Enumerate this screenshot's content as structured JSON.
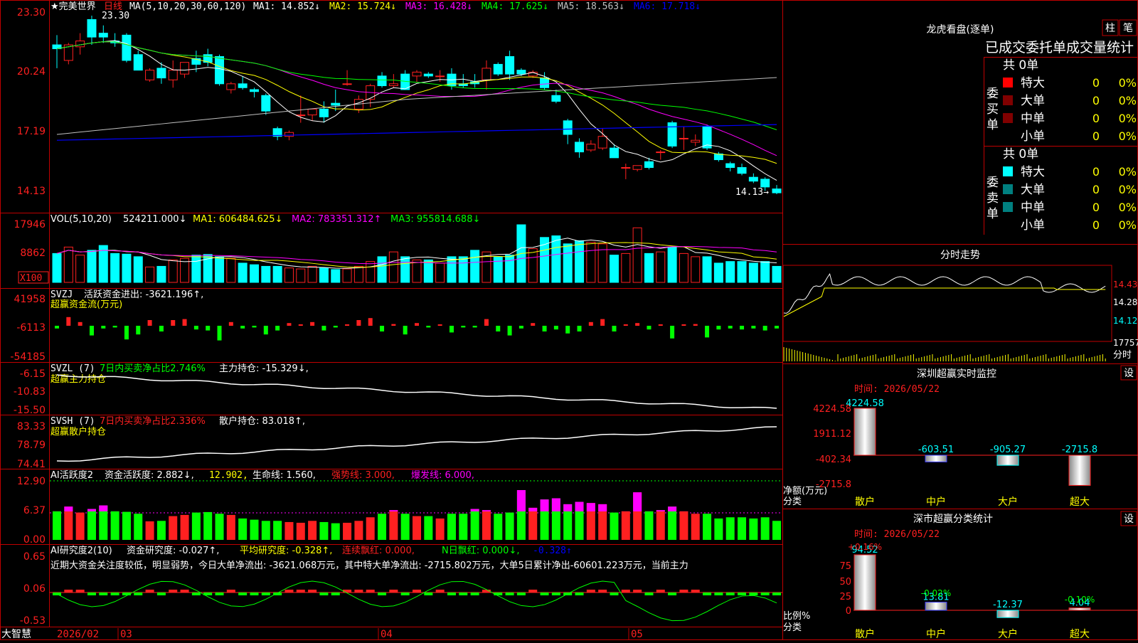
{
  "colors": {
    "up": "#ff2020",
    "down": "#00ffff",
    "frame": "#c00000",
    "ma1": "#ffffff",
    "ma2": "#ffff00",
    "ma3": "#ff00ff",
    "ma4": "#00ff00",
    "ma5": "#c0c0c0",
    "ma6": "#0000ff",
    "green": "#00ff00",
    "label": "#ffff00"
  },
  "kline": {
    "stock_name": "★完美世界",
    "period": "日线",
    "ma_label": "MA(5,10,20,30,60,120)",
    "ma_values": [
      "MA1: 14.852↓",
      "MA2: 15.724↓",
      "MA3: 16.428↓",
      "MA4: 17.625↓",
      "MA5: 18.563↓",
      "MA6: 17.718↓"
    ],
    "y_ticks": [
      "23.30",
      "20.24",
      "17.19",
      "14.13"
    ],
    "high_label": "23.30",
    "low_label": "14.13→"
  },
  "vol": {
    "label": "VOL(5,10,20)",
    "value": "524211.000↓",
    "ma_values": [
      "MA1: 606484.625↓",
      "MA2: 783351.312↑",
      "MA3: 955814.688↓"
    ],
    "y_ticks": [
      "17946",
      "8862"
    ],
    "unit": "X100"
  },
  "svzj": {
    "label": "SVZJ",
    "title": "活跃资金进出: -3621.196↑,",
    "sub": "超赢资金流(万元)",
    "y_ticks": [
      "41958",
      "-6113",
      "-54185"
    ]
  },
  "svzl": {
    "label": "SVZL (7)",
    "title1": "7日内买卖净占比2.746%",
    "title2": "主力持仓: -15.329↓,",
    "sub": "超赢主力持仓",
    "y_ticks": [
      "-6.15",
      "-10.83",
      "-15.50"
    ]
  },
  "svsh": {
    "label": "SVSH (7)",
    "title1": "7日内买卖净占比2.336%",
    "title2": "散户持仓: 83.018↑,",
    "sub": "超赢散户持仓",
    "y_ticks": [
      "83.33",
      "78.79",
      "74.41"
    ]
  },
  "ai1": {
    "label": "AI活跃度2",
    "title": "资金活跃度: 2.882↓,",
    "v1": "12.902,",
    "v2": "生命线: 1.560,",
    "v3": "强势线: 3.000,",
    "v4": "爆发线: 6.000,",
    "y_ticks": [
      "12.90",
      "6.37",
      "0.00"
    ]
  },
  "ai2": {
    "label": "AI研究度2(10)",
    "title": "资金研究度: -0.027↑,",
    "v1": "平均研究度: -0.328↑,",
    "v2": "连续飘红: 0.000,",
    "v3": "N日飘红: 0.000↓,",
    "v4": "-0.328↑",
    "comment": "近期大资金关注度较低，明显弱势，今日大单净流出: -3621.068万元，其中特大单净流出: -2715.802万元，大单5日累计净出-60601.223万元，当前主力",
    "y_ticks": [
      "0.65",
      "0.06",
      "-0.53"
    ]
  },
  "xaxis": {
    "brand": "大智慧",
    "labels": [
      "2026/02",
      "03",
      "04",
      "05"
    ]
  },
  "right": {
    "title": "龙虎看盘(逐单)",
    "btn1": "柱",
    "btn2": "笔",
    "subtitle": "已成交委托单成交量统计",
    "buy_group": {
      "label": "委买单",
      "total": "共 0单",
      "rows": [
        {
          "name": "特大",
          "v": "0",
          "p": "0%",
          "color": "#ff0000"
        },
        {
          "name": "大单",
          "v": "0",
          "p": "0%",
          "color": "#800000"
        },
        {
          "name": "中单",
          "v": "0",
          "p": "0%",
          "color": "#800000"
        },
        {
          "name": "小单",
          "v": "0",
          "p": "0%",
          "color": "#000000"
        }
      ]
    },
    "sell_group": {
      "label": "委卖单",
      "total": "共 0单",
      "rows": [
        {
          "name": "特大",
          "v": "0",
          "p": "0%",
          "color": "#00ffff"
        },
        {
          "name": "大单",
          "v": "0",
          "p": "0%",
          "color": "#008080"
        },
        {
          "name": "中单",
          "v": "0",
          "p": "0%",
          "color": "#008080"
        },
        {
          "name": "小单",
          "v": "0",
          "p": "0%",
          "color": "#000000"
        }
      ]
    },
    "intraday": {
      "title": "分时走势",
      "ticks": [
        "14.43",
        "14.28",
        "14.12"
      ],
      "vol_tick": "17757",
      "vol_label": "分时"
    },
    "monitor": {
      "title": "深圳超赢实时监控",
      "set": "设",
      "time": "时间: 2026/05/22",
      "y_ticks": [
        "4224.58",
        "1911.12",
        "-402.34",
        "-2715.8"
      ],
      "ylabel1": "净额(万元)",
      "ylabel2": "分类",
      "categories": [
        "散户",
        "中户",
        "大户",
        "超大"
      ],
      "values": [
        4224.58,
        -603.51,
        -905.27,
        -2715.8
      ],
      "value_labels": [
        "4224.58",
        "-603.51",
        "-905.27",
        "-2715.8"
      ]
    },
    "classify": {
      "title": "深市超赢分类统计",
      "set": "设",
      "time": "时间: 2026/05/22",
      "y_ticks": [
        "75",
        "50",
        "25",
        "0"
      ],
      "ylabel1": "比例%",
      "ylabel2": "分类",
      "categories": [
        "散户",
        "中户",
        "大户",
        "超大"
      ],
      "top_labels": [
        "+0.16%",
        "-0.02%",
        "",
        "-0.10%"
      ],
      "values": [
        94.52,
        13.81,
        -12.37,
        4.04
      ],
      "value_labels": [
        "94.52",
        "13.81",
        "-12.37",
        "4.04"
      ]
    }
  },
  "chart_data": {
    "type": "candlestick",
    "ohlc": [
      [
        21.8,
        22.3,
        20.6,
        21.6
      ],
      [
        21.0,
        21.9,
        20.8,
        21.8
      ],
      [
        21.7,
        22.4,
        21.3,
        22.0
      ],
      [
        23.1,
        23.3,
        21.8,
        22.2
      ],
      [
        22.4,
        22.8,
        21.9,
        22.2
      ],
      [
        22.0,
        22.4,
        21.7,
        21.9
      ],
      [
        22.3,
        22.4,
        20.9,
        21.0
      ],
      [
        21.3,
        21.5,
        20.5,
        20.5
      ],
      [
        20.0,
        20.6,
        19.9,
        20.5
      ],
      [
        20.6,
        20.9,
        19.8,
        20.1
      ],
      [
        20.0,
        21.0,
        19.6,
        20.5
      ],
      [
        20.3,
        20.9,
        20.1,
        20.9
      ],
      [
        21.1,
        21.5,
        20.4,
        20.8
      ],
      [
        21.3,
        21.6,
        20.7,
        20.9
      ],
      [
        21.2,
        21.3,
        19.7,
        19.8
      ],
      [
        19.5,
        19.9,
        19.3,
        19.8
      ],
      [
        19.8,
        20.2,
        19.5,
        19.6
      ],
      [
        19.5,
        19.6,
        19.1,
        19.4
      ],
      [
        19.2,
        19.3,
        18.2,
        18.4
      ],
      [
        17.5,
        17.6,
        16.9,
        17.1
      ],
      [
        17.1,
        17.4,
        16.9,
        17.3
      ],
      [
        18.2,
        19.2,
        17.8,
        18.2
      ],
      [
        18.2,
        18.5,
        17.9,
        18.5
      ],
      [
        18.5,
        18.9,
        17.8,
        18.1
      ],
      [
        18.8,
        19.5,
        18.4,
        18.7
      ],
      [
        19.8,
        20.5,
        19.7,
        19.8
      ],
      [
        18.5,
        19.2,
        18.3,
        19.0
      ],
      [
        19.0,
        19.8,
        18.6,
        19.7
      ],
      [
        20.2,
        20.4,
        19.6,
        19.7
      ],
      [
        19.7,
        20.3,
        19.6,
        19.8
      ],
      [
        20.3,
        20.5,
        19.5,
        19.5
      ],
      [
        20.2,
        20.5,
        19.9,
        20.4
      ],
      [
        20.3,
        20.4,
        20.1,
        20.2
      ],
      [
        20.2,
        20.5,
        19.9,
        20.2
      ],
      [
        20.3,
        20.6,
        19.5,
        19.7
      ],
      [
        19.8,
        20.3,
        19.6,
        19.7
      ],
      [
        19.9,
        20.3,
        19.6,
        19.8
      ],
      [
        20.0,
        21.0,
        19.5,
        20.6
      ],
      [
        20.8,
        20.9,
        20.2,
        20.3
      ],
      [
        21.2,
        21.5,
        20.0,
        20.3
      ],
      [
        20.5,
        20.6,
        20.2,
        20.3
      ],
      [
        20.2,
        20.5,
        20.1,
        20.4
      ],
      [
        20.1,
        20.4,
        19.5,
        19.6
      ],
      [
        19.2,
        19.5,
        18.8,
        18.9
      ],
      [
        17.9,
        18.0,
        16.7,
        17.2
      ],
      [
        16.8,
        17.0,
        16.0,
        16.3
      ],
      [
        16.4,
        16.9,
        16.3,
        16.7
      ],
      [
        16.5,
        17.5,
        16.4,
        17.1
      ],
      [
        16.5,
        16.7,
        16.0,
        16.0
      ],
      [
        15.5,
        15.7,
        14.9,
        15.5
      ],
      [
        15.4,
        15.6,
        15.3,
        15.6
      ],
      [
        15.8,
        16.0,
        15.4,
        15.5
      ],
      [
        16.3,
        16.4,
        15.9,
        16.3
      ],
      [
        17.8,
        17.9,
        16.5,
        16.6
      ],
      [
        17.0,
        17.6,
        16.4,
        17.0
      ],
      [
        16.8,
        17.2,
        16.6,
        16.9
      ],
      [
        17.6,
        17.7,
        16.4,
        16.5
      ],
      [
        16.2,
        16.3,
        15.8,
        15.9
      ],
      [
        15.7,
        15.8,
        15.3,
        15.5
      ],
      [
        15.5,
        15.7,
        15.1,
        15.2
      ],
      [
        15.0,
        15.2,
        14.7,
        14.8
      ],
      [
        14.9,
        15.0,
        14.3,
        14.5
      ],
      [
        14.4,
        14.6,
        14.13,
        14.2
      ]
    ],
    "volume": [
      9000,
      11000,
      8500,
      10000,
      11500,
      9000,
      8800,
      8000,
      4800,
      5000,
      7000,
      7500,
      8500,
      8700,
      8000,
      7500,
      6000,
      5500,
      5000,
      5000,
      4500,
      4200,
      5000,
      4500,
      4000,
      4200,
      5000,
      6500,
      8000,
      9500,
      8000,
      7000,
      7000,
      6000,
      8000,
      8000,
      10000,
      9500,
      8000,
      8500,
      17946,
      10500,
      14000,
      14500,
      12000,
      13000,
      12500,
      12000,
      8500,
      9000,
      17000,
      9000,
      9500,
      11000,
      9000,
      8000,
      8000,
      6000,
      6500,
      6500,
      6000,
      6500,
      5000
    ]
  }
}
